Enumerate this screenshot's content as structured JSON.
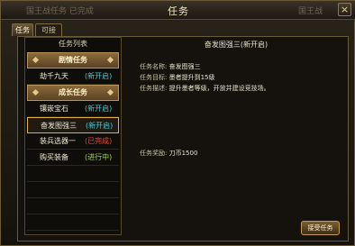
{
  "window": {
    "title": "任务",
    "ghost_left": "国王战任务 已完成",
    "ghost_right": "国王战",
    "close": "×"
  },
  "tabs": [
    "任务",
    "可接"
  ],
  "list": {
    "header": "任务列表",
    "rows": [
      {
        "kind": "cat",
        "name": "剧情任务"
      },
      {
        "kind": "quest",
        "name": "劫千九天",
        "status": "(新开启)",
        "tone": "new"
      },
      {
        "kind": "cat",
        "name": "成长任务"
      },
      {
        "kind": "quest",
        "name": "镶嵌宝石",
        "status": "(新开启)",
        "tone": "new"
      },
      {
        "kind": "quest",
        "name": "奋发图强三",
        "status": "(新开启)",
        "tone": "new",
        "selected": true
      },
      {
        "kind": "quest",
        "name": "装兵选器一",
        "status": "(已完成)",
        "tone": "done"
      },
      {
        "kind": "quest",
        "name": "购买装备",
        "status": "(进行中)",
        "tone": "prog"
      },
      {
        "kind": "empty"
      },
      {
        "kind": "empty"
      },
      {
        "kind": "empty"
      },
      {
        "kind": "empty"
      }
    ]
  },
  "detail": {
    "title": "奋发图强三(新开启)",
    "name_label": "任务名称:",
    "name_value": "奋发图强三",
    "goal_label": "任务目标:",
    "goal_value": "墨者提升到15级",
    "desc_label": "任务描述:",
    "desc_value": "提升墨者等级，开放并建设竞技场。",
    "reward_label": "任务奖励:",
    "reward_value": "刀币1500"
  },
  "accept_button": "接受任务"
}
